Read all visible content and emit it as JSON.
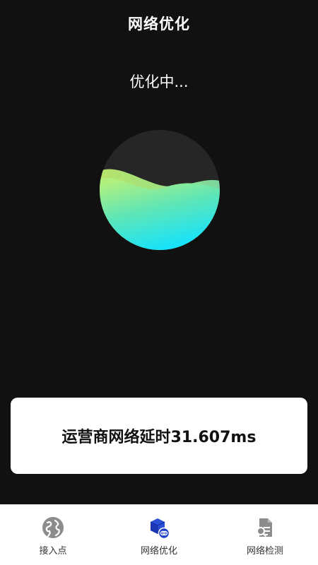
{
  "header": {
    "title": "网络优化"
  },
  "status": {
    "text": "优化中..."
  },
  "progress": {
    "fill_level": 0.55
  },
  "result": {
    "text": "运营商网络延时31.607ms"
  },
  "tabs": [
    {
      "label": "接入点",
      "icon": "globe-icon",
      "active": false
    },
    {
      "label": "网络优化",
      "icon": "cube-link-icon",
      "active": true
    },
    {
      "label": "网络检测",
      "icon": "document-search-icon",
      "active": false
    }
  ],
  "colors": {
    "background": "#111111",
    "wave_green": "#a6ef8a",
    "wave_cyan": "#1ee6ff",
    "tab_active_icon": "#1b3ec9",
    "tab_inactive_icon": "#888888"
  }
}
